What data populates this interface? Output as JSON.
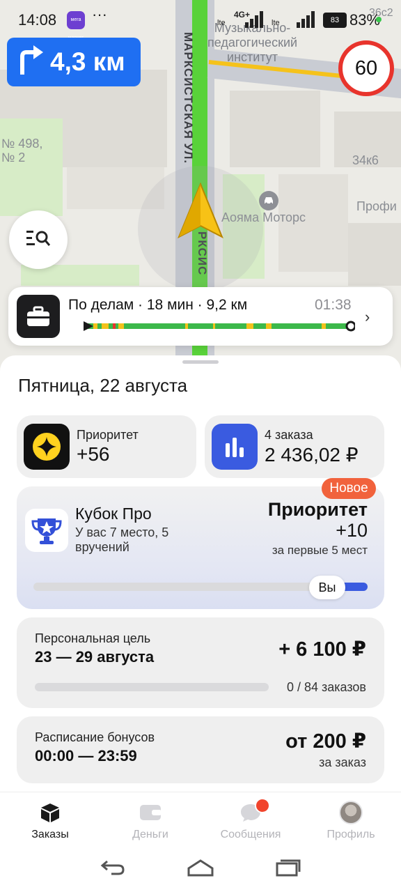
{
  "status_bar": {
    "time": "14:08",
    "app_icon_text": "мега маркет",
    "more": "···",
    "network_1": "4G+",
    "battery_level": "83",
    "battery_percent": "83%"
  },
  "map": {
    "street_name": "МАРКСИСТСКАЯ УЛ.",
    "street_name_short": "РКСИС",
    "poi_institute": "Музыкально-\nпедагогический\nинститут",
    "poi_aoyama": "Аояма Моторс",
    "house_label_1": "№ 498,",
    "house_label_2": "№ 2",
    "building_label": "34к6",
    "place_label": "Профи",
    "corner_label": "36с2"
  },
  "maneuver": {
    "icon": "turn-right-icon",
    "distance": "4,3 км"
  },
  "speed_limit": "60",
  "route": {
    "title": "По делам · 18 мин · 9,2 км",
    "time": "01:38",
    "icon": "briefcase-icon"
  },
  "sheet": {
    "date": "Пятница, 22 августа",
    "priority": {
      "label": "Приоритет",
      "value": "+56"
    },
    "orders": {
      "label": "4 заказа",
      "value": "2 436,02 ₽"
    },
    "cup": {
      "badge": "Новое",
      "title": "Кубок Про",
      "subtitle": "У вас 7 место, 5\nвручений",
      "reward_title": "Приоритет",
      "reward_value": "+10",
      "reward_note": "за первые 5 мест",
      "you_label": "Вы"
    },
    "goal": {
      "label": "Персональная цель",
      "dates": "23 — 29 августа",
      "value": "+ 6 100 ₽",
      "progress_text": "0 / 84 заказов",
      "progress": 0
    },
    "schedule": {
      "label": "Расписание бонусов",
      "hours": "00:00 — 23:59",
      "value": "от 200 ₽",
      "note": "за заказ"
    }
  },
  "tabs": [
    {
      "label": "Заказы",
      "icon": "orders-icon",
      "active": true
    },
    {
      "label": "Деньги",
      "icon": "wallet-icon",
      "active": false
    },
    {
      "label": "Сообщения",
      "icon": "messages-icon",
      "active": false
    },
    {
      "label": "Профиль",
      "icon": "avatar",
      "active": false
    }
  ],
  "colors": {
    "route_green": "#59d23a",
    "maneuver_blue": "#1f6ff2",
    "speed_red": "#e8342c",
    "priority_yellow": "#ffd21f",
    "orders_blue": "#3a5be0",
    "badge_orange": "#f1623c"
  }
}
